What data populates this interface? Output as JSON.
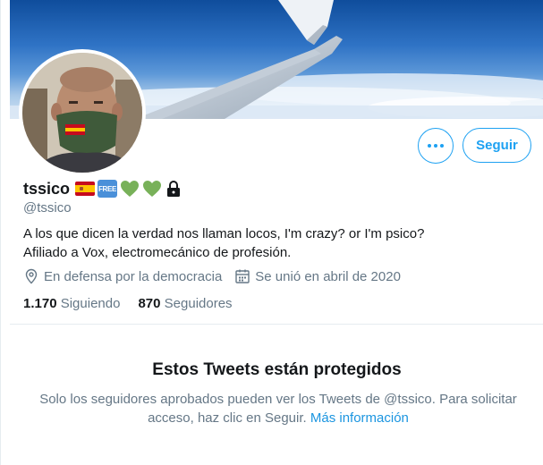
{
  "profile": {
    "display_name": "tssico",
    "handle": "@tssico",
    "bio_line1": "A los que dicen la verdad nos llaman locos, I'm crazy? or I'm psico?",
    "bio_line2": "Afiliado a Vox, electromecánico de profesión.",
    "location": "En defensa por la democracia",
    "joined": "Se unió en abril de 2020",
    "following_count": "1.170",
    "following_label": "Siguiendo",
    "followers_count": "870",
    "followers_label": "Seguidores",
    "badges": [
      "spain-flag-emoji",
      "free-button-emoji",
      "green-heart-emoji",
      "green-heart-emoji",
      "lock-icon"
    ],
    "free_badge_text": "FREE"
  },
  "actions": {
    "follow_label": "Seguir",
    "more_icon": "more-dots-icon"
  },
  "protected": {
    "title": "Estos Tweets están protegidos",
    "text": "Solo los seguidores aprobados pueden ver los Tweets de @tssico. Para solicitar acceso, haz clic en Seguir.",
    "link": "Más información"
  },
  "colors": {
    "accent": "#1da1f2",
    "secondary_text": "#657786",
    "primary_text": "#14171a",
    "divider": "#e6ecf0"
  }
}
